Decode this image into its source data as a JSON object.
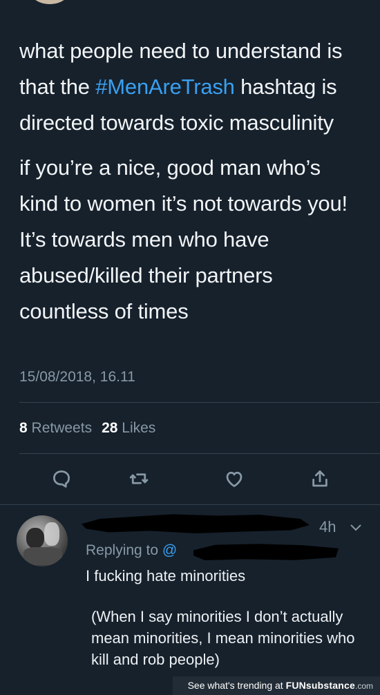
{
  "tweet": {
    "paragraph1_before": "what people need to understand is that the ",
    "hashtag": "#MenAreTrash",
    "paragraph1_after": " hashtag is directed towards toxic masculinity",
    "paragraph2": "if you’re a nice, good man who’s kind to women it’s not towards you! It’s towards men who have abused/killed their partners countless of times",
    "timestamp": "15/08/2018, 16.11",
    "retweet_count": "8",
    "retweet_label": "Retweets",
    "like_count": "28",
    "like_label": "Likes"
  },
  "actions": {
    "reply_icon": "reply-icon",
    "retweet_icon": "retweet-icon",
    "like_icon": "heart-icon",
    "share_icon": "share-icon"
  },
  "reply": {
    "time": "4h",
    "replying_label": "Replying to ",
    "handle_prefix": "@",
    "line1": "I fucking hate minorities",
    "line2": "(When I say minorities I don’t actually mean minorities, I mean minorities who kill and rob people)"
  },
  "footer": {
    "trend_text": "See what's trending at ",
    "brand": "FUNsubstance",
    "tld": ".com"
  },
  "colors": {
    "background": "#16212c",
    "link": "#3aa0f0",
    "muted": "#8899a6"
  }
}
